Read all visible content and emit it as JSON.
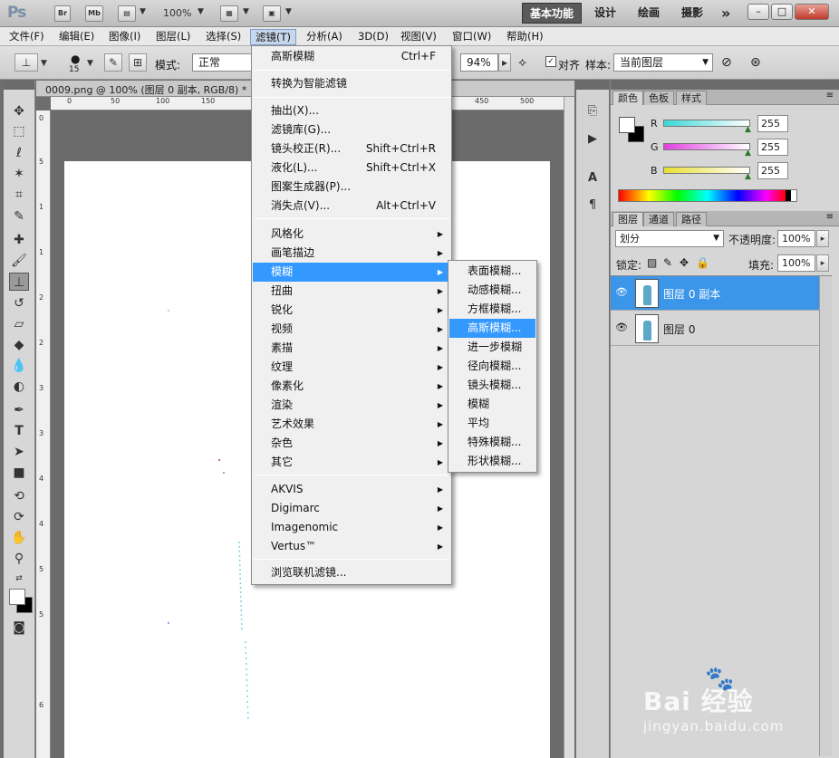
{
  "app": {
    "logo": "Ps",
    "zoom": "100%"
  },
  "appbar": {
    "buttons": [
      "Br",
      "Mb"
    ],
    "workspaces": [
      "基本功能",
      "设计",
      "绘画",
      "摄影"
    ],
    "more": "»"
  },
  "menubar": {
    "items": [
      "文件(F)",
      "编辑(E)",
      "图像(I)",
      "图层(L)",
      "选择(S)",
      "滤镜(T)",
      "分析(A)",
      "3D(D)",
      "视图(V)",
      "窗口(W)",
      "帮助(H)"
    ]
  },
  "options": {
    "brush_size": "15",
    "mode_label": "模式:",
    "mode_value": "正常",
    "flow_value": "94%",
    "aligned_label": "对齐",
    "aligned_checked": true,
    "sample_label": "样本:",
    "sample_value": "当前图层"
  },
  "document": {
    "tab_title": "0009.png @ 100% (图层 0 副本, RGB/8) *",
    "ruler_h": [
      "0",
      "50",
      "100",
      "150",
      "450",
      "500"
    ],
    "ruler_v": [
      "0",
      "5",
      "1",
      "1",
      "2",
      "2",
      "3",
      "3",
      "4",
      "4",
      "5",
      "5",
      "6"
    ]
  },
  "filter_menu": {
    "items": [
      {
        "label": "高斯模糊",
        "shortcut": "Ctrl+F"
      },
      {
        "label": "转换为智能滤镜",
        "shortcut": ""
      },
      {
        "label": "抽出(X)...",
        "shortcut": ""
      },
      {
        "label": "滤镜库(G)...",
        "shortcut": ""
      },
      {
        "label": "镜头校正(R)...",
        "shortcut": "Shift+Ctrl+R"
      },
      {
        "label": "液化(L)...",
        "shortcut": "Shift+Ctrl+X"
      },
      {
        "label": "图案生成器(P)...",
        "shortcut": ""
      },
      {
        "label": "消失点(V)...",
        "shortcut": "Alt+Ctrl+V"
      },
      {
        "label": "风格化",
        "shortcut": ""
      },
      {
        "label": "画笔描边",
        "shortcut": ""
      },
      {
        "label": "模糊",
        "shortcut": ""
      },
      {
        "label": "扭曲",
        "shortcut": ""
      },
      {
        "label": "锐化",
        "shortcut": ""
      },
      {
        "label": "视频",
        "shortcut": ""
      },
      {
        "label": "素描",
        "shortcut": ""
      },
      {
        "label": "纹理",
        "shortcut": ""
      },
      {
        "label": "像素化",
        "shortcut": ""
      },
      {
        "label": "渲染",
        "shortcut": ""
      },
      {
        "label": "艺术效果",
        "shortcut": ""
      },
      {
        "label": "杂色",
        "shortcut": ""
      },
      {
        "label": "其它",
        "shortcut": ""
      },
      {
        "label": "AKVIS",
        "shortcut": ""
      },
      {
        "label": "Digimarc",
        "shortcut": ""
      },
      {
        "label": "Imagenomic",
        "shortcut": ""
      },
      {
        "label": "Vertus™",
        "shortcut": ""
      },
      {
        "label": "浏览联机滤镜...",
        "shortcut": ""
      }
    ]
  },
  "blur_submenu": {
    "items": [
      "表面模糊...",
      "动感模糊...",
      "方框模糊...",
      "高斯模糊...",
      "进一步模糊",
      "径向模糊...",
      "镜头模糊...",
      "模糊",
      "平均",
      "特殊模糊...",
      "形状模糊..."
    ],
    "highlighted": "高斯模糊..."
  },
  "color_panel": {
    "tabs": [
      "颜色",
      "色板",
      "样式"
    ],
    "r_label": "R",
    "g_label": "G",
    "b_label": "B",
    "r": "255",
    "g": "255",
    "b": "255",
    "r_color": "#3ad8d8",
    "g_color": "#e040e0",
    "b_color": "#e8e030"
  },
  "layers_panel": {
    "tabs": [
      "图层",
      "通道",
      "路径"
    ],
    "blend_mode": "划分",
    "opacity_label": "不透明度:",
    "opacity_value": "100%",
    "lock_label": "锁定:",
    "fill_label": "填充:",
    "fill_value": "100%",
    "layers": [
      {
        "name": "图层 0 副本",
        "selected": true
      },
      {
        "name": "图层 0",
        "selected": false
      }
    ]
  },
  "watermark": {
    "brand": "Bai  经验",
    "url": "jingyan.baidu.com"
  },
  "colors": {
    "accent": "#3399ff",
    "selection": "#3b95e9"
  }
}
